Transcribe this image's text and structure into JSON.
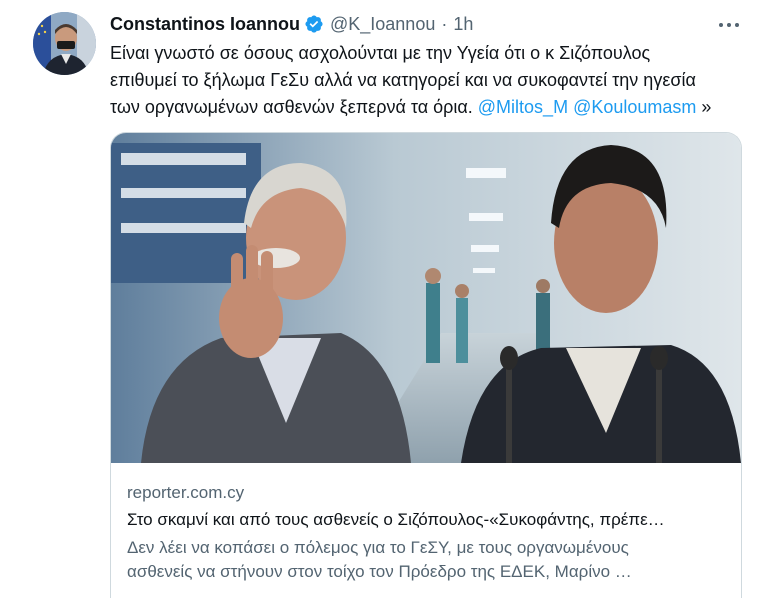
{
  "author": {
    "name": "Constantinos Ioannou",
    "handle": "@K_Ioannou",
    "separator": "·",
    "time": "1h",
    "verified_icon": "verified-badge-icon",
    "avatar_icon": "profile-photo",
    "verified_color": "#1d9bf0"
  },
  "tweet": {
    "text_line_1": "Είναι γνωστό σε όσους ασχολούνται με την Υγεία ότι ο κ Σιζόπουλος",
    "text_line_2": "επιθυμεί το ξήλωμα ΓεΣυ αλλά να κατηγορεί και να συκοφαντεί την ηγεσία",
    "text_line_3_start": "των οργανωμένων ασθενών ξεπερνά τα όρια. ",
    "mention_1": "@Miltos_M",
    "mention_2": "@Kouloumasm",
    "text_end": " »"
  },
  "card": {
    "domain": "reporter.com.cy",
    "title": "Στο σκαμνί και από τους ασθενείς ο Σιζόπουλος-«Συκοφάντης, πρέπε…",
    "description_line_1": "Δεν λέει να κοπάσει ο πόλεμος για το ΓεΣΥ, με τους οργανωμένους",
    "description_line_2": "ασθενείς να στήνουν στον τοίχο τον Πρόεδρο της ΕΔΕΚ, Μαρίνο …"
  },
  "colors": {
    "text": "#0f1419",
    "secondary": "#536471",
    "link": "#1d9bf0",
    "border": "#cfd9de"
  }
}
